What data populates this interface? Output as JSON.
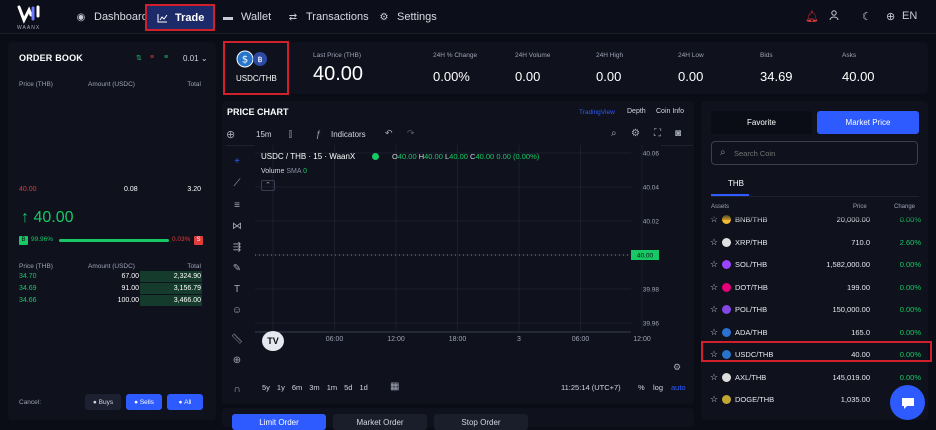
{
  "nav": {
    "logo_text": "WAANX",
    "items": [
      {
        "label": "Dashboard",
        "icon": "palette-icon"
      },
      {
        "label": "Trade",
        "icon": "chart-line-icon"
      },
      {
        "label": "Wallet",
        "icon": "wallet-icon"
      },
      {
        "label": "Transactions",
        "icon": "swap-arrows-icon"
      },
      {
        "label": "Settings",
        "icon": "gear-icon"
      }
    ],
    "lang": "EN"
  },
  "order_book": {
    "title": "ORDER BOOK",
    "precision": "0.01",
    "headers": [
      "Price (THB)",
      "Amount (USDC)",
      "Total"
    ],
    "sell_row": {
      "price": "40.00",
      "amount": "0.08",
      "total": "3.20"
    },
    "last_price": "40.00",
    "buy_pct": "99.96%",
    "sell_pct": "0.03%",
    "buy_label": "B",
    "sell_label": "S",
    "buy_headers": [
      "Price (THB)",
      "Amount (USDC)",
      "Total"
    ],
    "buy_rows": [
      {
        "price": "34.70",
        "amount": "67.00",
        "total": "2,324.90"
      },
      {
        "price": "34.69",
        "amount": "91.00",
        "total": "3,156.79"
      },
      {
        "price": "34.66",
        "amount": "100.00",
        "total": "3,466.00"
      }
    ],
    "cancel_label": "Cancel:",
    "cancel_buttons": [
      "Buys",
      "Sells",
      "All"
    ]
  },
  "pair": {
    "label": "USDC/THB"
  },
  "ticker": [
    {
      "label": "Last Price (THB)",
      "value": "40.00"
    },
    {
      "label": "24H % Change",
      "value": "0.00%"
    },
    {
      "label": "24H Volume",
      "value": "0.00"
    },
    {
      "label": "24H High",
      "value": "0.00"
    },
    {
      "label": "24H Low",
      "value": "0.00"
    },
    {
      "label": "Bids",
      "value": "34.69"
    },
    {
      "label": "Asks",
      "value": "40.00"
    }
  ],
  "chart": {
    "title": "PRICE CHART",
    "tabs": [
      "TradingView",
      "Depth",
      "Coin Info"
    ],
    "interval": "15m",
    "indicators": "Indicators",
    "symbol_line": "USDC / THB · 15 · WaanX",
    "ohlc": {
      "o": "40.00",
      "h": "40.00",
      "l": "40.00",
      "c": "40.00",
      "chg": "0.00 (0.00%)"
    },
    "volume_label": "Volume",
    "volume_sma": "SMA",
    "volume_val": "0",
    "price_ticks": [
      "40.06",
      "40.04",
      "40.02",
      "40.00",
      "39.98",
      "39.96"
    ],
    "time_ticks": [
      "2",
      "06:00",
      "12:00",
      "18:00",
      "3",
      "06:00",
      "12:00"
    ],
    "ranges": [
      "5y",
      "1y",
      "6m",
      "3m",
      "1m",
      "5d",
      "1d"
    ],
    "clock": "11:25:14 (UTC+7)",
    "pct": "%",
    "log": "log",
    "auto": "auto",
    "price_badge": "40.00"
  },
  "order_tabs": [
    "Limit Order",
    "Market Order",
    "Stop Order"
  ],
  "market": {
    "tabs": [
      "Favorite",
      "Market Price"
    ],
    "search_placeholder": "Search Coin",
    "quote_tab": "THB",
    "headers": [
      "Assets",
      "Price",
      "Change"
    ],
    "rows": [
      {
        "name": "BNB/THB",
        "price": "20,000.00",
        "change": "0.00%",
        "color": "#f3ba2f"
      },
      {
        "name": "XRP/THB",
        "price": "710.0",
        "change": "2.60%",
        "color": "#e0e0e0"
      },
      {
        "name": "SOL/THB",
        "price": "1,582,000.00",
        "change": "0.00%",
        "color": "#9945ff"
      },
      {
        "name": "DOT/THB",
        "price": "199.00",
        "change": "0.00%",
        "color": "#e6007a"
      },
      {
        "name": "POL/THB",
        "price": "150,000.00",
        "change": "0.00%",
        "color": "#8247e5"
      },
      {
        "name": "ADA/THB",
        "price": "165.0",
        "change": "0.00%",
        "color": "#2a71d0"
      },
      {
        "name": "USDC/THB",
        "price": "40.00",
        "change": "0.00%",
        "color": "#2775ca"
      },
      {
        "name": "AXL/THB",
        "price": "145,019.00",
        "change": "0.00%",
        "color": "#dddddd"
      },
      {
        "name": "DOGE/THB",
        "price": "1,035.00",
        "change": "0.00%",
        "color": "#c2a633"
      }
    ]
  },
  "colors": {
    "accent": "#2d5bff",
    "buy": "#17c964",
    "sell": "#e23b3b",
    "highlight": "#d1202b"
  }
}
